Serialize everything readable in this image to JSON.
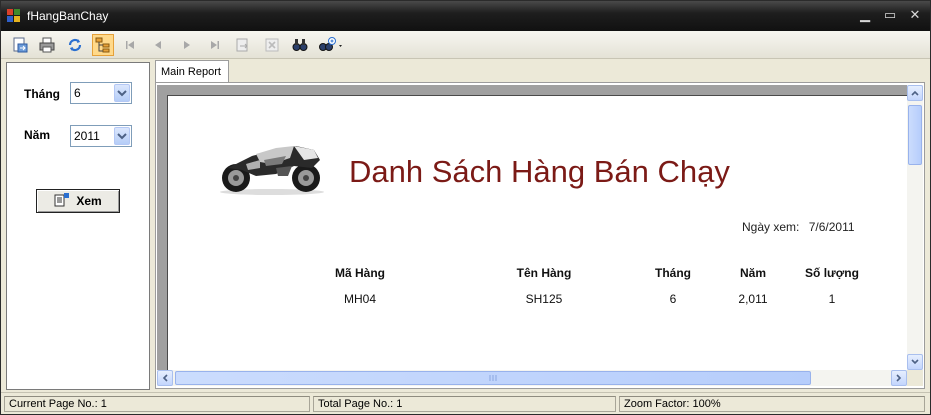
{
  "window": {
    "title": "fHangBanChay"
  },
  "toolbar": {
    "icons": [
      "export-icon",
      "print-icon",
      "refresh-icon",
      "group-tree-icon",
      "first-page-icon",
      "prev-page-icon",
      "next-page-icon",
      "last-page-icon",
      "goto-page-icon",
      "close-view-icon",
      "search-icon",
      "zoom-icon"
    ]
  },
  "filter": {
    "month_label": "Tháng",
    "month_value": "6",
    "year_label": "Năm",
    "year_value": "2011",
    "view_button_label": "Xem"
  },
  "report": {
    "tab_label": "Main Report",
    "title": "Danh Sách Hàng Bán Chạy",
    "date_label": "Ngày xem:",
    "date_value": "7/6/2011",
    "columns": [
      "Mã Hàng",
      "Tên Hàng",
      "Tháng",
      "Năm",
      "Số lượng"
    ],
    "rows": [
      [
        "MH04",
        "SH125",
        "6",
        "2,011",
        "1"
      ]
    ],
    "title_color": "#7b1a16"
  },
  "statusbar": {
    "current_page": "Current Page No.: 1",
    "total_page": "Total Page No.: 1",
    "zoom": "Zoom Factor: 100%"
  }
}
